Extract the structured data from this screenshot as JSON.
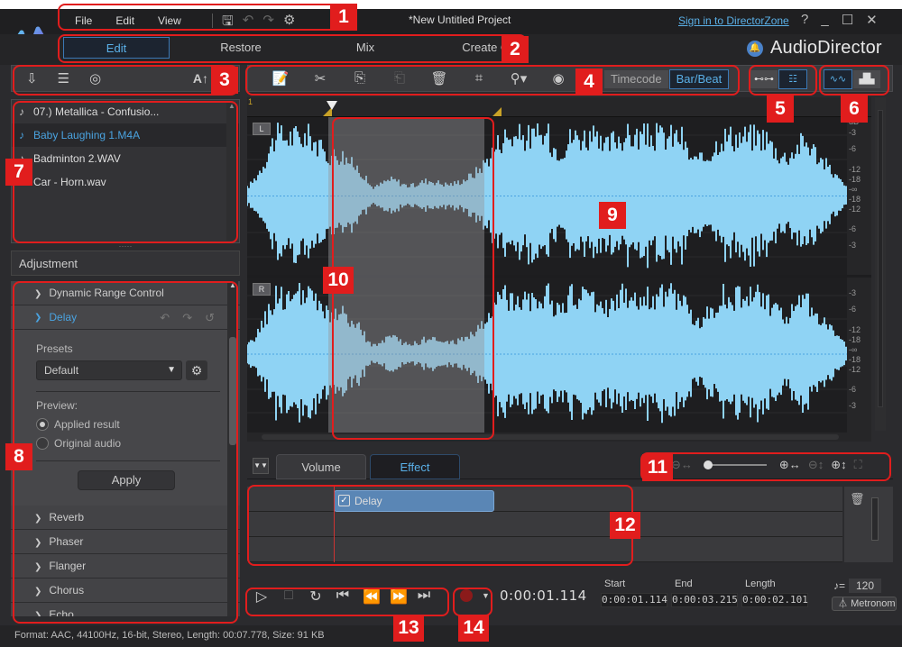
{
  "titlebar": {
    "menu": [
      "File",
      "Edit",
      "View"
    ],
    "project_title": "*New Untitled Project",
    "signin_link": "Sign in to DirectorZone",
    "window_controls": [
      "?",
      "_",
      "☐",
      "✕"
    ]
  },
  "modes": {
    "items": [
      "Edit",
      "Restore",
      "Mix",
      "Create CD"
    ],
    "active": "Edit"
  },
  "brand": {
    "name": "AudioDirector"
  },
  "library": {
    "items": [
      {
        "label": "07.) Metallica - Confusio...",
        "selected": false
      },
      {
        "label": "Baby Laughing 1.M4A",
        "selected": true
      },
      {
        "label": "Badminton 2.WAV",
        "selected": false
      },
      {
        "label": "Car - Horn.wav",
        "selected": false
      }
    ],
    "toolbar_text_icon": "A↑"
  },
  "adjustment": {
    "title": "Adjustment",
    "effects_before": [
      "Dynamic Range Control"
    ],
    "open_effect": "Delay",
    "presets_label": "Presets",
    "preset_value": "Default",
    "preview_label": "Preview:",
    "preview_options": [
      {
        "label": "Applied result",
        "selected": true
      },
      {
        "label": "Original audio",
        "selected": false
      }
    ],
    "apply_label": "Apply",
    "effects_after": [
      "Reverb",
      "Phaser",
      "Flanger",
      "Chorus",
      "Echo"
    ]
  },
  "toolbar": {
    "time_modes": [
      "Timecode",
      "Bar/Beat"
    ],
    "active_time_mode": "Bar/Beat"
  },
  "ruler": {
    "start_label": "1"
  },
  "channels": [
    {
      "label": "L"
    },
    {
      "label": "R"
    }
  ],
  "db_scale": {
    "unit": "dB",
    "labels": [
      "-3",
      "-6",
      "-12",
      "-18",
      "-∞",
      "-18",
      "-12",
      "-6",
      "-3"
    ]
  },
  "selection": {
    "start_fraction": 0.135,
    "end_fraction": 0.395
  },
  "bottom_tabs": {
    "items": [
      "Volume",
      "Effect"
    ],
    "active": "Effect"
  },
  "zoom": {
    "horizontal_level": 0.0
  },
  "effect_lane": {
    "clip_label": "Delay",
    "clip_checked": true
  },
  "transport": {
    "current_time": "0:00:01.114",
    "start_label": "Start",
    "start_value": "0:00:01.114",
    "end_label": "End",
    "end_value": "0:00:03.215",
    "length_label": "Length",
    "length_value": "0:00:02.101",
    "tempo_symbol": "♪=",
    "tempo_value": "120",
    "metronome_label": "Metronome"
  },
  "status": {
    "text": "Format: AAC, 44100Hz, 16-bit, Stereo, Length: 00:07.778, Size: 91 KB"
  },
  "callouts": [
    "1",
    "2",
    "3",
    "4",
    "5",
    "6",
    "7",
    "8",
    "9",
    "10",
    "11",
    "12",
    "13",
    "14"
  ],
  "colors": {
    "accent": "#4aa3e0",
    "waveform": "#8fd3f4",
    "callout": "#e11d1d",
    "marker": "#c9a227"
  }
}
